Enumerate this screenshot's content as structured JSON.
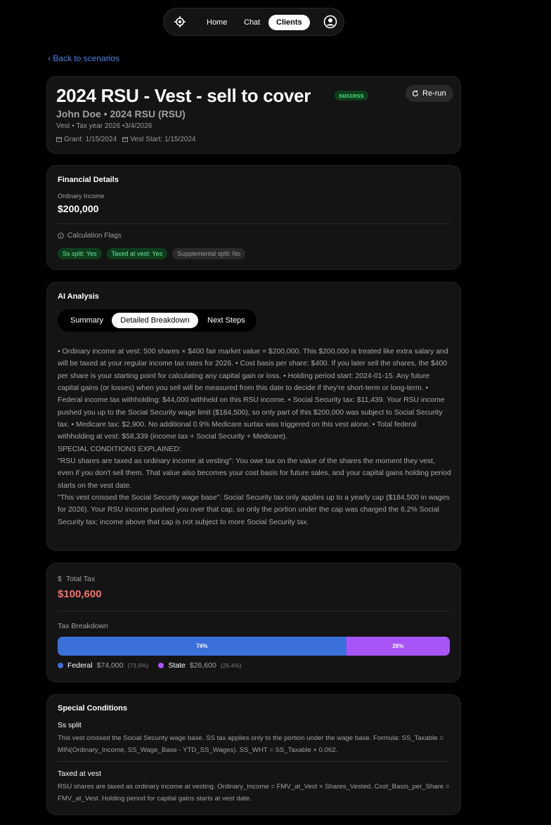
{
  "nav": {
    "logo_icon": "crosshair-logo-icon",
    "home": "Home",
    "chat": "Chat",
    "clients": "Clients",
    "user_icon": "user-circle-icon"
  },
  "back_link": "‹  Back to scenarios",
  "header": {
    "title": "2024 RSU - Vest - sell to cover",
    "status": "success",
    "rerun": "Re-run",
    "subtitle": "John Doe • 2024 RSU (RSU)",
    "meta": "Vest • Tax year 2026 •3/4/2026",
    "grant": "Grant: 1/15/2024",
    "vest_start": "Vest Start: 1/15/2024"
  },
  "financial": {
    "title": "Financial Details",
    "ordinary_income_label": "Ordinary Income",
    "ordinary_income_value": "$200,000",
    "flags_label": "Calculation Flags",
    "flags": [
      "Ss split: Yes",
      "Taxed at vest: Yes",
      "Supplemental split: No"
    ]
  },
  "ai": {
    "title": "AI Analysis",
    "tabs": [
      "Summary",
      "Detailed Breakdown",
      "Next Steps"
    ],
    "active_tab": "Detailed Breakdown",
    "paragraph1": "• Ordinary income at vest: 500 shares × $400 fair market value = $200,000. This $200,000 is treated like extra salary and will be taxed at your regular income tax rates for 2026. • Cost basis per share: $400. If you later sell the shares, the $400 per share is your starting point for calculating any capital gain or loss. • Holding period start: 2024-01-15. Any future capital gains (or losses) when you sell will be measured from this date to decide if they're short-term or long-term. • Federal income tax withholding: $44,000 withheld on this RSU income. • Social Security tax: $11,439. Your RSU income pushed you up to the Social Security wage limit ($184,500), so only part of this $200,000 was subject to Social Security tax. • Medicare tax: $2,900. No additional 0.9% Medicare surtax was triggered on this vest alone. • Total federal withholding at vest: $58,339 (income tax + Social Security + Medicare).",
    "special_heading": "SPECIAL CONDITIONS EXPLAINED:",
    "paragraph2": "\"RSU shares are taxed as ordinary income at vesting\": You owe tax on the value of the shares the moment they vest, even if you don't sell them. That value also becomes your cost basis for future sales, and your capital gains holding period starts on the vest date.",
    "paragraph3": "\"This vest crossed the Social Security wage base\": Social Security tax only applies up to a yearly cap ($184,500 in wages for 2026). Your RSU income pushed you over that cap, so only the portion under the cap was charged the 6.2% Social Security tax; income above that cap is not subject to more Social Security tax."
  },
  "tax": {
    "total_label": "Total Tax",
    "total_value": "$100,600",
    "breakdown_label": "Tax Breakdown",
    "federal": {
      "name": "Federal",
      "amount": "$74,000",
      "pct": "(73.6%)",
      "bar_label": "74%",
      "fraction": 0.736,
      "color": "#3b6fd9"
    },
    "state": {
      "name": "State",
      "amount": "$26,600",
      "pct": "(26.4%)",
      "bar_label": "26%",
      "fraction": 0.264,
      "color": "#a855f7"
    }
  },
  "special": {
    "title": "Special Conditions",
    "items": [
      {
        "name": "Ss split",
        "desc": "This vest crossed the Social Security wage base. SS tax applies only to the portion under the wage base. Formula: SS_Taxable = MIN(Ordinary_Income, SS_Wage_Base - YTD_SS_Wages). SS_WHT = SS_Taxable × 0.062."
      },
      {
        "name": "Taxed at vest",
        "desc": "RSU shares are taxed as ordinary income at vesting. Ordinary_Income = FMV_at_Vest × Shares_Vested. Cost_Basis_per_Share = FMV_at_Vest. Holding period for capital gains starts at vest date."
      }
    ]
  }
}
